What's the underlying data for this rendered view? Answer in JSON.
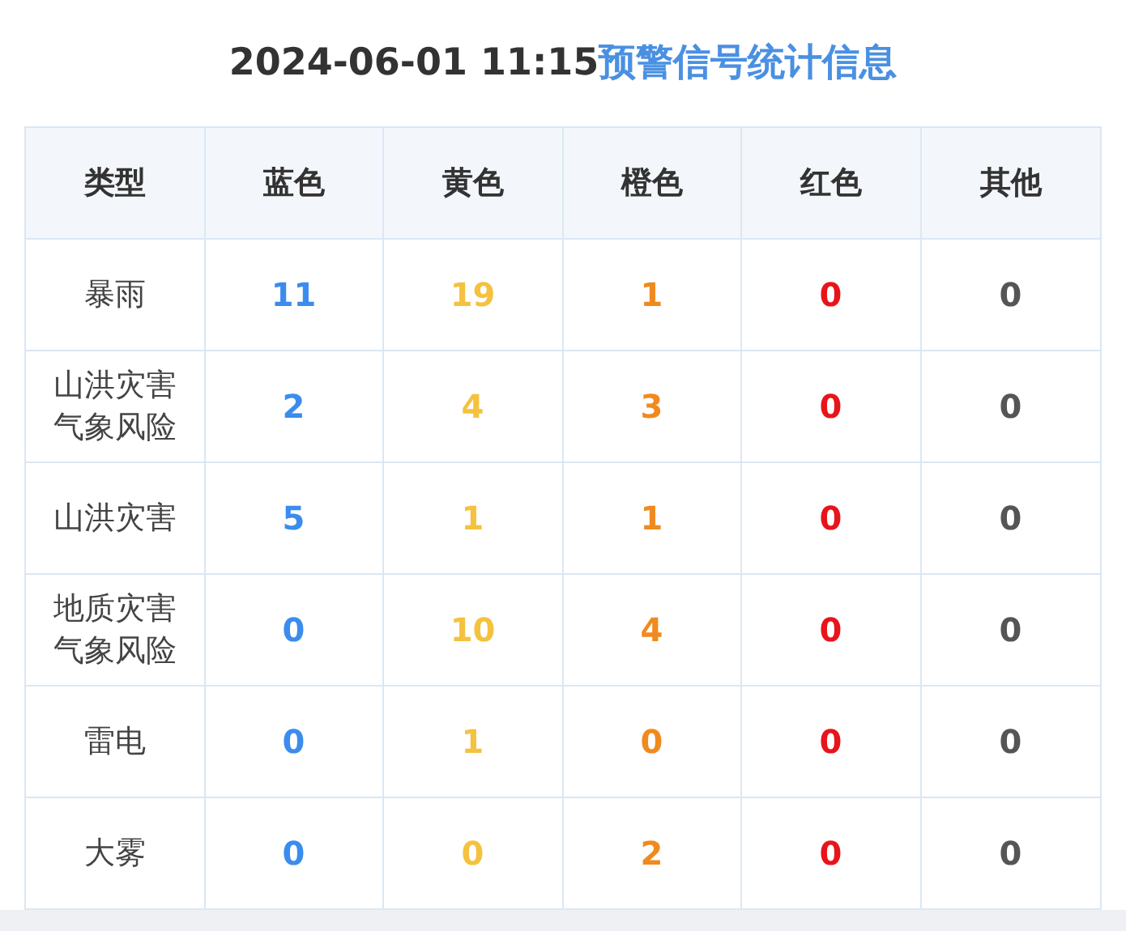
{
  "title": {
    "datetime": "2024-06-01 11:15",
    "label": "预警信号统计信息"
  },
  "columns": [
    {
      "label": "类型"
    },
    {
      "label": "蓝色",
      "color": "#3b8ced"
    },
    {
      "label": "黄色",
      "color": "#f4c23f"
    },
    {
      "label": "橙色",
      "color": "#f08a1e"
    },
    {
      "label": "红色",
      "color": "#e8141b"
    },
    {
      "label": "其他",
      "color": "#555555"
    }
  ],
  "rows": [
    {
      "type": "暴雨",
      "values": [
        "11",
        "19",
        "1",
        "0",
        "0"
      ]
    },
    {
      "type": "山洪灾害气象风险",
      "values": [
        "2",
        "4",
        "3",
        "0",
        "0"
      ]
    },
    {
      "type": "山洪灾害",
      "values": [
        "5",
        "1",
        "1",
        "0",
        "0"
      ]
    },
    {
      "type": "地质灾害气象风险",
      "values": [
        "0",
        "10",
        "4",
        "0",
        "0"
      ]
    },
    {
      "type": "雷电",
      "values": [
        "0",
        "1",
        "0",
        "0",
        "0"
      ]
    },
    {
      "type": "大雾",
      "values": [
        "0",
        "0",
        "2",
        "0",
        "0"
      ]
    }
  ]
}
